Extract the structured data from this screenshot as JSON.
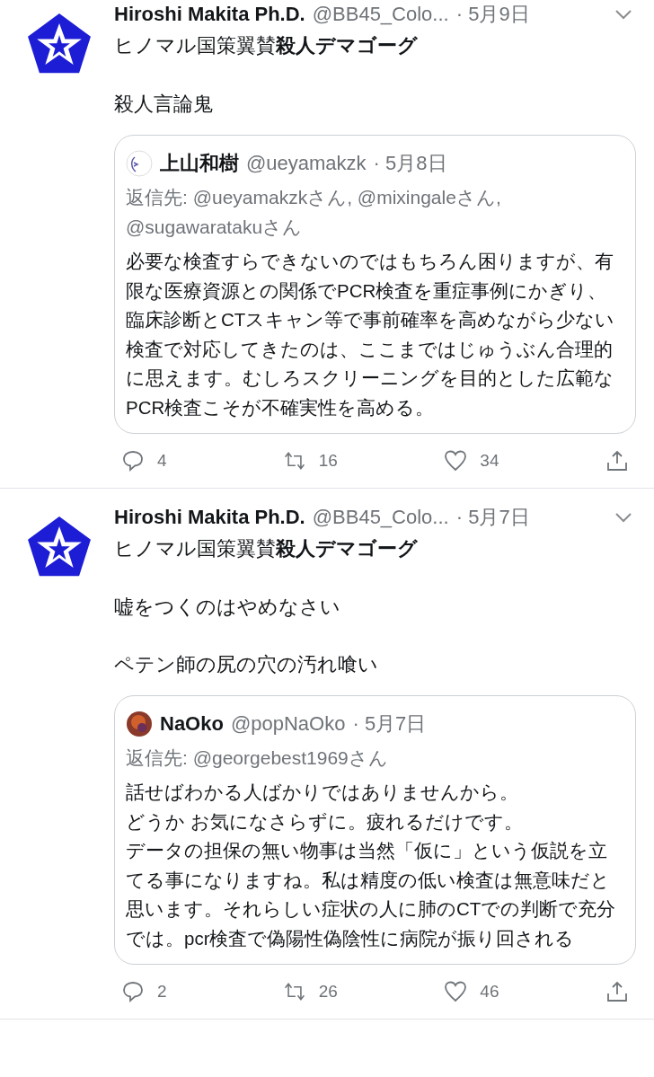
{
  "tweets": [
    {
      "name": "Hiroshi Makita Ph.D.",
      "handle": "@BB45_Colo...",
      "date": "· 5月9日",
      "name_line_2": "ヒノマル国策翼賛**殺人デマゴーグ**",
      "paragraphs": [
        "殺人言論鬼"
      ],
      "quote": {
        "avatar": {
          "kind": "sketch"
        },
        "name": "上山和樹",
        "handle": "@ueyamakzk",
        "date": "· 5月8日",
        "reply_to": "返信先: @ueyamakzkさん, @mixingaleさん, @sugawaratakuさん",
        "paragraphs": [
          "必要な検査すらできないのではもちろん困りますが、有限な医療資源との関係でPCR検査を重症事例にかぎり、臨床診断とCTスキャン等で事前確率を高めながら少ない検査で対応してきたのは、ここまではじゅうぶん合理的に思えます。むしろスクリーニングを目的とした広範なPCR検査こそが不確実性を高める。"
        ]
      },
      "replies": "4",
      "retweets": "16",
      "likes": "34"
    },
    {
      "name": "Hiroshi Makita Ph.D.",
      "handle": "@BB45_Colo...",
      "date": "· 5月7日",
      "name_line_2": "ヒノマル国策翼賛**殺人デマゴーグ**",
      "paragraphs": [
        "嘘をつくのはやめなさい",
        "ペテン師の尻の穴の汚れ喰い"
      ],
      "quote": {
        "avatar": {
          "kind": "photo"
        },
        "name": "NaOko",
        "handle": "@popNaOko",
        "date": "· 5月7日",
        "reply_to": "返信先: @georgebest1969さん",
        "paragraphs": [
          "話せばわかる人ばかりではありませんから。",
          "どうか お気になさらずに。疲れるだけです。",
          "データの担保の無い物事は当然「仮に」という仮説を立てる事になりますね。私は精度の低い検査は無意味だと思います。それらしい症状の人に肺のCTでの判断で充分では。pcr検査で偽陽性偽陰性に病院が振り回される"
        ]
      },
      "replies": "2",
      "retweets": "26",
      "likes": "46"
    }
  ]
}
